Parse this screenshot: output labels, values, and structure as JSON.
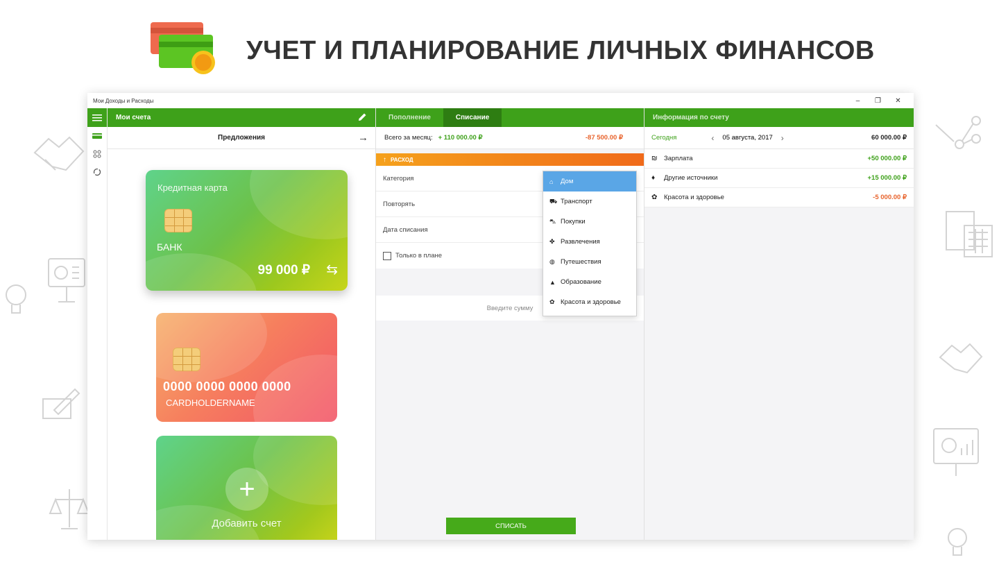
{
  "hero": {
    "title": "УЧЕТ И ПЛАНИРОВАНИЕ ЛИЧНЫХ ФИНАНСОВ"
  },
  "window": {
    "title": "Мои Доходы и Расходы",
    "controls": {
      "minimize": "–",
      "restore": "❐",
      "close": "✕"
    }
  },
  "rail": {
    "menu_icon": "hamburger-icon",
    "items": [
      {
        "icon": "cards-icon",
        "glyph": "▬"
      },
      {
        "icon": "apps-icon",
        "glyph": "⁘"
      },
      {
        "icon": "refresh-icon",
        "glyph": "◌"
      }
    ]
  },
  "accounts": {
    "header": "Мои счета",
    "edit_icon": "pencil-icon",
    "offers_label": "Предложения",
    "offers_arrow": "→",
    "card1": {
      "title": "Кредитная карта",
      "bank": "БАНК",
      "amount": "99 000 ₽",
      "swap": "⇆"
    },
    "card2": {
      "number": "0000 0000 0000 0000",
      "holder": "CARDHOLDERNAME"
    },
    "card3": {
      "plus": "+",
      "label": "Добавить счет"
    }
  },
  "middle": {
    "tabs": [
      {
        "label": "Пополнение"
      },
      {
        "label": "Списание"
      }
    ],
    "totals": {
      "label": "Всего за месяц:",
      "income": "+ 110 000.00 ₽",
      "expense": "-87 500.00 ₽"
    },
    "expense_bar": {
      "arrow": "↑",
      "label": "РАСХОД"
    },
    "fields": {
      "category": "Категория",
      "repeat": "Повторять",
      "date": "Дата списания",
      "plan_only": "Только в плане"
    },
    "amount_placeholder": "Введите сумму",
    "submit": "СПИСАТЬ",
    "dropdown": [
      {
        "icon": "home-icon",
        "glyph": "⌂",
        "label": "Дом",
        "selected": true
      },
      {
        "icon": "car-icon",
        "glyph": "⛟",
        "label": "Транспорт"
      },
      {
        "icon": "cart-icon",
        "glyph": "⛍",
        "label": "Покупки"
      },
      {
        "icon": "puzzle-icon",
        "glyph": "✤",
        "label": "Развлечения"
      },
      {
        "icon": "globe-icon",
        "glyph": "◍",
        "label": "Путешествия"
      },
      {
        "icon": "graduation-cap-icon",
        "glyph": "▲",
        "label": "Образование"
      },
      {
        "icon": "flower-icon",
        "glyph": "✿",
        "label": "Красота и здоровье"
      }
    ]
  },
  "right": {
    "header": "Информация по счету",
    "date_row": {
      "today": "Сегодня",
      "prev": "‹",
      "date": "05 августа, 2017",
      "next": "›",
      "balance": "60 000.00 ₽"
    },
    "transactions": [
      {
        "icon": "salary-icon",
        "glyph": "₪",
        "label": "Зарплата",
        "value": "+50 000.00 ₽",
        "sign": "pos"
      },
      {
        "icon": "money-bag-icon",
        "glyph": "♦",
        "label": "Другие источники",
        "value": "+15 000.00 ₽",
        "sign": "pos"
      },
      {
        "icon": "flower-icon",
        "glyph": "✿",
        "label": "Красота и здоровье",
        "value": "-5 000.00 ₽",
        "sign": "neg"
      }
    ]
  }
}
